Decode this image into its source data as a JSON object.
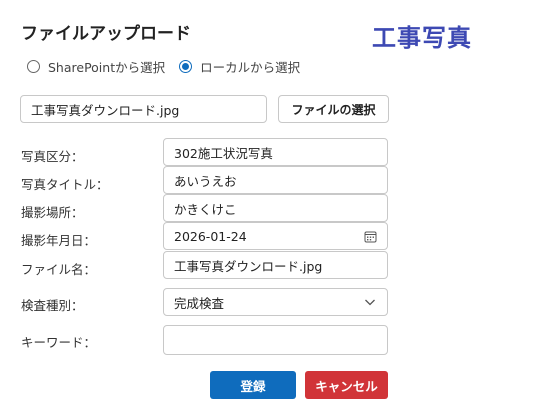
{
  "header": {
    "title": "ファイルアップロード",
    "brand": "工事写真"
  },
  "source_options": {
    "sharepoint_label": "SharePointから選択",
    "local_label": "ローカルから選択",
    "selected": "local"
  },
  "file": {
    "current_name": "工事写真ダウンロード.jpg",
    "select_button": "ファイルの選択"
  },
  "form": {
    "photo_category": {
      "label": "写真区分：",
      "value": "302施工状況写真"
    },
    "photo_title": {
      "label": "写真タイトル：",
      "value": "あいうえお"
    },
    "location": {
      "label": "撮影場所：",
      "value": "かきくけこ"
    },
    "date": {
      "label": "撮影年月日：",
      "value": "2026-01-24",
      "icon": "calendar-icon"
    },
    "file_name": {
      "label": "ファイル名：",
      "value": "工事写真ダウンロード.jpg"
    },
    "inspection_type": {
      "label": "検査種別：",
      "value": "完成検査",
      "icon": "chevron-down-icon"
    },
    "keyword": {
      "label": "キーワード：",
      "value": ""
    }
  },
  "actions": {
    "register": "登録",
    "cancel": "キャンセル"
  },
  "colors": {
    "accent": "#0f6cbd",
    "brand": "#3d49b3",
    "danger": "#d13438"
  }
}
